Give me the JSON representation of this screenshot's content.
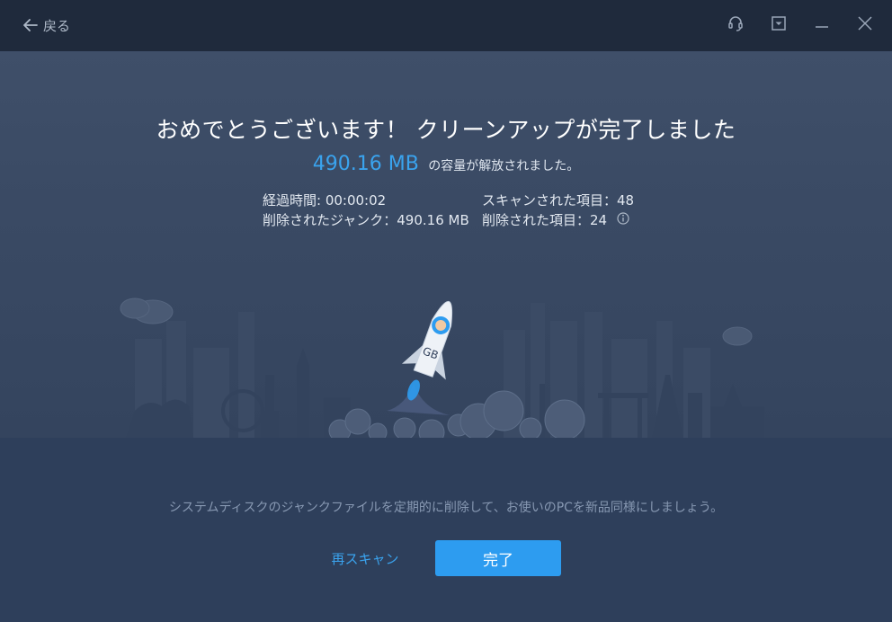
{
  "titlebar": {
    "back_label": "戻る"
  },
  "icons": {
    "back": "arrow-left-icon",
    "support": "headset-icon",
    "menu": "dropdown-menu-icon",
    "minimize": "minimize-icon",
    "close": "close-icon",
    "info": "info-icon"
  },
  "result": {
    "headline": "おめでとうございます！ クリーンアップが完了しました",
    "freed_amount": "490.16 MB",
    "freed_suffix": "の容量が解放されました。",
    "stats": {
      "elapsed": "経過時間: 00:00:02",
      "scanned": "スキャンされた項目：48",
      "junk_removed": "削除されたジャンク：490.16 MB",
      "items_removed": "削除された項目：24"
    }
  },
  "rocket_label": "GB",
  "tip": "システムディスクのジャンクファイルを定期的に削除して、お使いのPCを新品同様にしましょう。",
  "actions": {
    "rescan_label": "再スキャン",
    "done_label": "完了"
  },
  "colors": {
    "accent": "#2d9cf0",
    "titlebar": "#1f2a3c",
    "background": "#3a4a64"
  }
}
